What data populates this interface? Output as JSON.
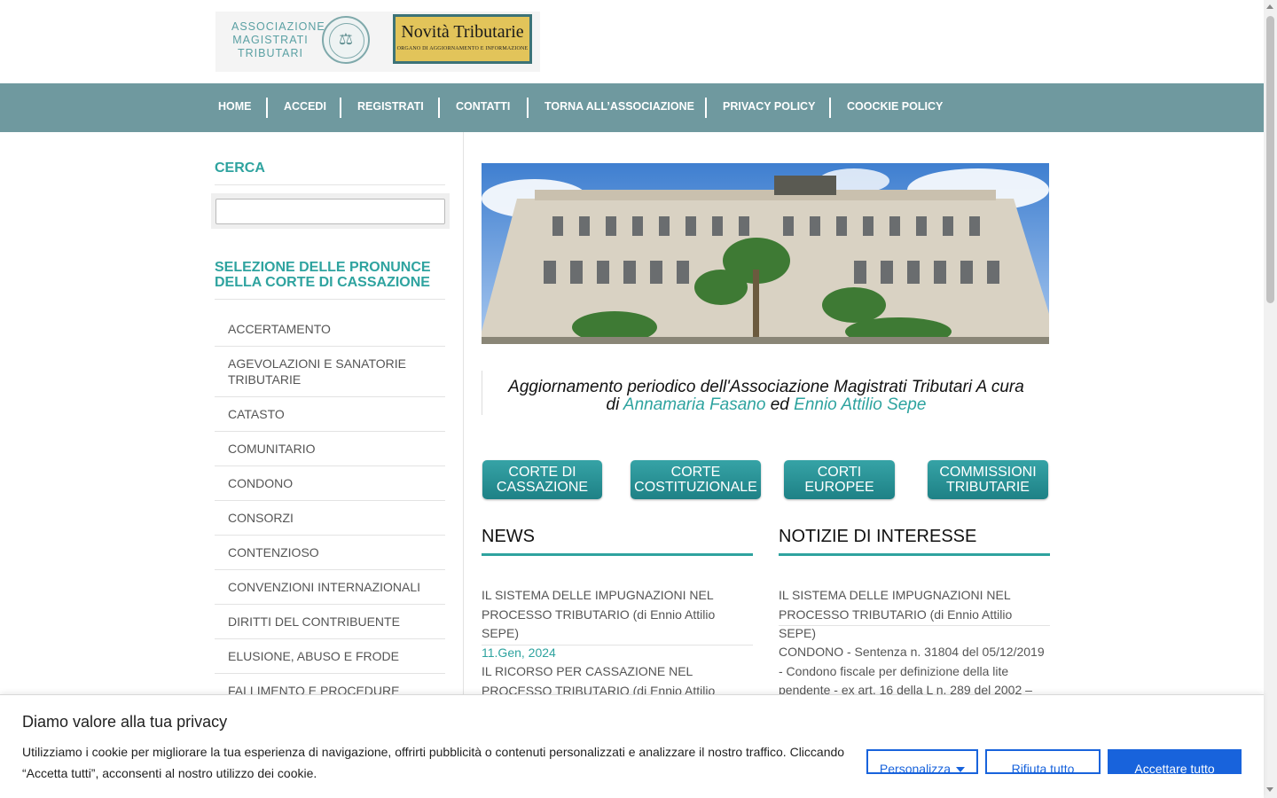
{
  "header": {
    "logo_lines": [
      "ASSOCIAZIONE",
      "MAGISTRATI",
      "TRIBUTARI"
    ],
    "novita_title": "Novità Tributarie",
    "novita_subtitle": "ORGANO DI AGGIORNAMENTO E INFORMAZIONE"
  },
  "nav": {
    "items": [
      "HOME",
      "ACCEDI",
      "REGISTRATI",
      "CONTATTI",
      "TORNA ALL’ASSOCIAZIONE",
      "PRIVACY POLICY",
      "COOCKIE POLICY"
    ]
  },
  "sidebar": {
    "search_title": "CERCA",
    "search_placeholder": "",
    "section_title": "SELEZIONE DELLE PRONUNCE DELLA CORTE DI CASSAZIONE",
    "categories": [
      "ACCERTAMENTO",
      "AGEVOLAZIONI E SANATORIE TRIBUTARIE",
      "CATASTO",
      "COMUNITARIO",
      "CONDONO",
      "CONSORZI",
      "CONTENZIOSO",
      "CONVENZIONI INTERNAZIONALI",
      "DIRITTI DEL CONTRIBUENTE",
      "ELUSIONE, ABUSO E FRODE",
      "FALLIMENTO E PROCEDURE CONCORSUALI"
    ]
  },
  "main": {
    "quote_prefix": "Aggiornamento periodico dell'Associazione Magistrati Tributari A cura di",
    "author1": "Annamaria Fasano",
    "quote_mid": "ed",
    "author2": "Ennio Attilio Sepe",
    "buttons": [
      "CORTE DI CASSAZIONE",
      "CORTE COSTITUZIONALE",
      "CORTI EUROPEE",
      "COMMISSIONI TRIBUTARIE"
    ],
    "news_title": "NEWS",
    "news": [
      {
        "text": "IL SISTEMA DELLE IMPUGNAZIONI NEL PROCESSO TRIBUTARIO (di Ennio Attilio SEPE)",
        "date": "11.Gen, 2024"
      },
      {
        "text": "IL RICORSO PER CASSAZIONE NEL PROCESSO TRIBUTARIO (di Ennio Attilio SEPE)",
        "date": ""
      }
    ],
    "interest_title": "NOTIZIE DI INTERESSE",
    "interest": [
      "IL SISTEMA DELLE IMPUGNAZIONI NEL PROCESSO TRIBUTARIO (di Ennio Attilio SEPE)",
      "CONDONO - Sentenza n. 31804 del 05/12/2019  - Condono fiscale per definizione della  lite pendente -  ex art. 16 della L n. 289 del 2002 –"
    ]
  },
  "cookie": {
    "title": "Diamo valore alla tua privacy",
    "text": "Utilizziamo i cookie per migliorare la tua esperienza di navigazione, offrirti pubblicità o contenuti personalizzati e analizzare il nostro traffico. Cliccando “Accetta tutti”, acconsenti al nostro utilizzo dei cookie.",
    "customize_label": "Personalizza",
    "reject_label": "Rifiuta tutto",
    "accept_label": "Accettare tutto"
  },
  "colors": {
    "accent": "#2ea39f",
    "nav_bg": "#6f999f",
    "cookie_blue": "#1863dc"
  }
}
